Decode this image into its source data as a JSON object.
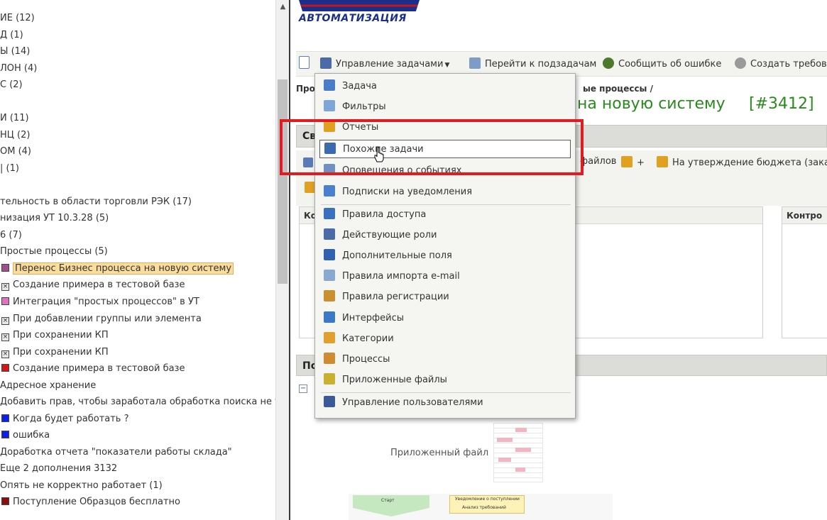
{
  "tree": {
    "items": [
      {
        "label": "ИЕ (12)"
      },
      {
        "label": "Д (1)"
      },
      {
        "label": "Ы (14)"
      },
      {
        "label": "ЛОН (4)"
      },
      {
        "label": "С (2)"
      },
      {
        "label": "И (11)"
      },
      {
        "label": "НЦ (2)"
      },
      {
        "label": "ОМ (4)"
      },
      {
        "label": "| (1)"
      },
      {
        "label": "тельность в области торговли РЭК (17)"
      },
      {
        "label": "низация УТ 10.3.28 (5)"
      },
      {
        "label": "6 (7)"
      },
      {
        "label": "Простые процессы (5)"
      },
      {
        "label": "Перенос Бизнес процесса на новую систему",
        "marker_color": "#a0508c",
        "selected": true
      },
      {
        "label": "Создание примера в тестовой базе",
        "marker_color": "#e8e8e8",
        "marker_glyph": "x"
      },
      {
        "label": "Интеграция \"простых процессов\" в УТ",
        "marker_color": "#e070c0"
      },
      {
        "label": "При добавлении группы или элемента",
        "marker_color": "#e8e8e8",
        "marker_glyph": "x"
      },
      {
        "label": "При сохранении КП",
        "marker_color": "#e8e8e8",
        "marker_glyph": "x"
      },
      {
        "label": "При сохранении КП",
        "marker_color": "#e8e8e8",
        "marker_glyph": "x"
      },
      {
        "label": "Создание примера в тестовой базе",
        "marker_color": "#d01818"
      },
      {
        "label": "Адресное хранение"
      },
      {
        "label": "Добавить прав, чтобы заработала обработка поиска не тольк"
      },
      {
        "label": "Когда будет работать ?",
        "marker_color": "#1020e0"
      },
      {
        "label": "ошибка",
        "marker_color": "#1020e0"
      },
      {
        "label": "Доработка отчета \"показатели работы склада\""
      },
      {
        "label": "Еще 2 дополнения 3132"
      },
      {
        "label": "Опять не корректно работает (1)"
      },
      {
        "label": "Поступление Образцов бесплатно",
        "marker_color": "#8a1010"
      }
    ]
  },
  "logo": {
    "text": "АВТОМАТИЗАЦИЯ"
  },
  "toolbar": {
    "manage_tasks": "Управление задачами",
    "go_subtasks": "Перейти к подзадачам",
    "report_error": "Сообщить об ошибке",
    "create_requirement": "Создать требов"
  },
  "breadcrumb": {
    "left": "Про",
    "right": "ые процессы /"
  },
  "task": {
    "title": "на новую систему",
    "id": "[#3412]"
  },
  "sections": {
    "details": "Св",
    "comments": "По",
    "panel_left": "Ко",
    "panel_right": "Контро"
  },
  "actions": {
    "files": "файлов",
    "plus": "+",
    "budget": "На утверждение бюджета (зака"
  },
  "attachment": {
    "label": "Приложенный файл"
  },
  "diagram_thumb": {
    "start": "Старт",
    "box1": "Уведомление о поступлении",
    "box2": "Анализ требований"
  },
  "menu": {
    "items": [
      {
        "label": "Задача",
        "icon": "task-icon",
        "color": "#4a7cc8"
      },
      {
        "label": "Фильтры",
        "icon": "filter-icon",
        "color": "#7fa6d8"
      },
      {
        "label": "Отчеты",
        "icon": "chart-icon",
        "color": "#e0a020"
      },
      {
        "label": "Похожие задачи",
        "icon": "similar-tasks-icon",
        "color": "#3a6ab0",
        "active": true
      },
      {
        "label": "Оповещения о событиях",
        "icon": "notification-icon",
        "color": "#7090c0"
      },
      {
        "label": "Подписки на уведомления",
        "icon": "subscription-icon",
        "color": "#4a80d0"
      },
      {
        "label": "Правила доступа",
        "icon": "access-rules-icon",
        "color": "#3a70c0"
      },
      {
        "label": "Действующие роли",
        "icon": "roles-icon",
        "color": "#4a6aa8"
      },
      {
        "label": "Дополнительные поля",
        "icon": "fields-icon",
        "color": "#3060b0"
      },
      {
        "label": "Правила импорта e-mail",
        "icon": "email-import-icon",
        "color": "#8aa8d0"
      },
      {
        "label": "Правила регистрации",
        "icon": "registration-icon",
        "color": "#c89030"
      },
      {
        "label": "Интерфейсы",
        "icon": "interface-icon",
        "color": "#3a78c8"
      },
      {
        "label": "Категории",
        "icon": "categories-icon",
        "color": "#e0a030"
      },
      {
        "label": "Процессы",
        "icon": "process-icon",
        "color": "#d08a30"
      },
      {
        "label": "Приложенные файлы",
        "icon": "attachment-icon",
        "color": "#c8b030"
      },
      {
        "label": "Управление пользователями",
        "icon": "users-icon",
        "color": "#3a5a98"
      }
    ]
  },
  "colors": {
    "highlight": "#e21b23",
    "title": "#2b8a1e",
    "selected_bg": "#fadc9b"
  }
}
